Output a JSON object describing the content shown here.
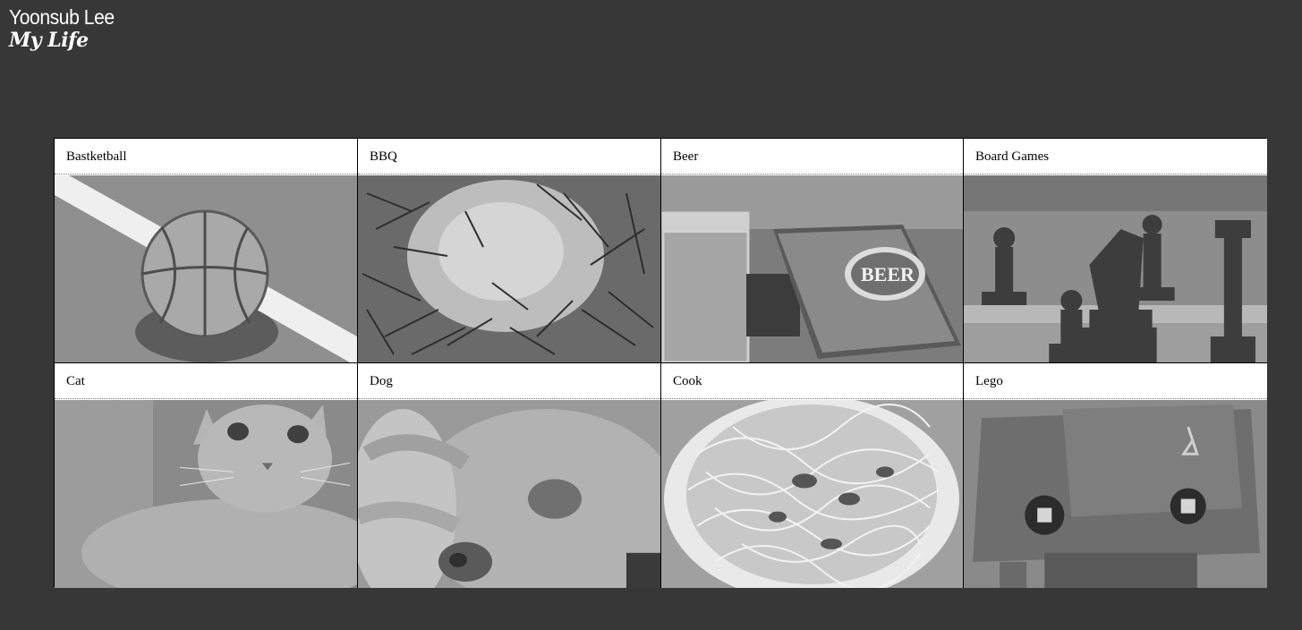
{
  "header": {
    "name": "Yoonsub Lee",
    "subtitle": "My Life"
  },
  "cards": [
    {
      "title": "Bastketball",
      "image_icon": "basketball-icon"
    },
    {
      "title": "BBQ",
      "image_icon": "bbq-icon"
    },
    {
      "title": "Beer",
      "image_icon": "beer-icon"
    },
    {
      "title": "Board Games",
      "image_icon": "chess-icon"
    },
    {
      "title": "Cat",
      "image_icon": "cat-icon"
    },
    {
      "title": "Dog",
      "image_icon": "dog-icon"
    },
    {
      "title": "Cook",
      "image_icon": "spaghetti-icon"
    },
    {
      "title": "Lego",
      "image_icon": "lego-icon"
    }
  ],
  "colors": {
    "page_background": "#373737",
    "header_text": "#ffffff",
    "card_title_background": "#ffffff",
    "photo_tint": "#8a8a8a"
  }
}
